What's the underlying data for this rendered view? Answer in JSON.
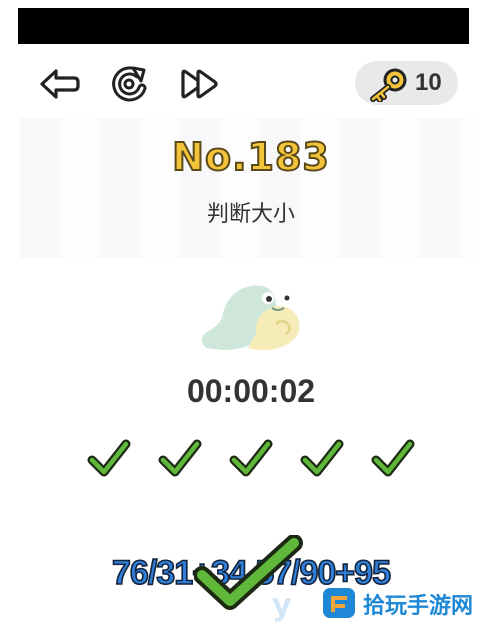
{
  "header": {
    "back_icon": "back-arrow-icon",
    "restart_icon": "restart-icon",
    "skip_icon": "fast-forward-icon",
    "keys_icon": "key-icon",
    "keys_count": "10"
  },
  "level": {
    "number": "No.183",
    "title": "判断大小"
  },
  "timer": "00:00:02",
  "progress": {
    "checks_completed": 5,
    "check_icon": "check-icon"
  },
  "question": {
    "expression": "76/31+34  57/90+95"
  },
  "watermark": {
    "text": "拾玩手游网"
  },
  "colors": {
    "level_text": "#f3c33a",
    "question_text": "#2f7fd8",
    "check_green": "#5fb83a",
    "watermark_blue": "#1e88d6"
  }
}
